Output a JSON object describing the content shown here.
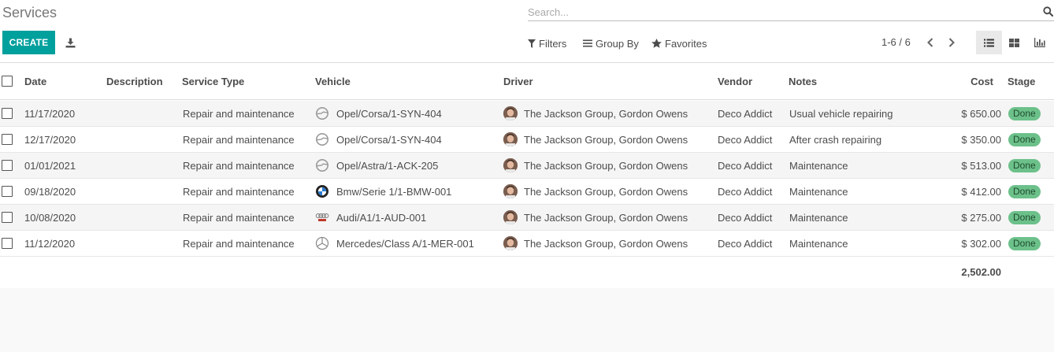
{
  "page": {
    "title": "Services"
  },
  "search": {
    "placeholder": "Search..."
  },
  "buttons": {
    "create": "CREATE"
  },
  "toolbar": {
    "filters": "Filters",
    "group_by": "Group By",
    "favorites": "Favorites"
  },
  "pager": {
    "value": "1-6 / 6"
  },
  "views": [
    "list",
    "kanban",
    "graph"
  ],
  "active_view": "list",
  "table": {
    "columns": {
      "date": "Date",
      "description": "Description",
      "service_type": "Service Type",
      "vehicle": "Vehicle",
      "driver": "Driver",
      "vendor": "Vendor",
      "notes": "Notes",
      "cost": "Cost",
      "stage": "Stage"
    },
    "rows": [
      {
        "date": "11/17/2020",
        "description": "",
        "service_type": "Repair and maintenance",
        "vehicle": "Opel/Corsa/1-SYN-404",
        "vehicle_icon": "opel-logo-icon",
        "driver": "The Jackson Group, Gordon Owens",
        "vendor": "Deco Addict",
        "notes": "Usual vehicle repairing",
        "cost": "$ 650.00",
        "stage": "Done"
      },
      {
        "date": "12/17/2020",
        "description": "",
        "service_type": "Repair and maintenance",
        "vehicle": "Opel/Corsa/1-SYN-404",
        "vehicle_icon": "opel-logo-icon",
        "driver": "The Jackson Group, Gordon Owens",
        "vendor": "Deco Addict",
        "notes": "After crash repairing",
        "cost": "$ 350.00",
        "stage": "Done"
      },
      {
        "date": "01/01/2021",
        "description": "",
        "service_type": "Repair and maintenance",
        "vehicle": "Opel/Astra/1-ACK-205",
        "vehicle_icon": "opel-logo-icon",
        "driver": "The Jackson Group, Gordon Owens",
        "vendor": "Deco Addict",
        "notes": "Maintenance",
        "cost": "$ 513.00",
        "stage": "Done"
      },
      {
        "date": "09/18/2020",
        "description": "",
        "service_type": "Repair and maintenance",
        "vehicle": "Bmw/Serie 1/1-BMW-001",
        "vehicle_icon": "bmw-logo-icon",
        "driver": "The Jackson Group, Gordon Owens",
        "vendor": "Deco Addict",
        "notes": "Maintenance",
        "cost": "$ 412.00",
        "stage": "Done"
      },
      {
        "date": "10/08/2020",
        "description": "",
        "service_type": "Repair and maintenance",
        "vehicle": "Audi/A1/1-AUD-001",
        "vehicle_icon": "audi-logo-icon",
        "driver": "The Jackson Group, Gordon Owens",
        "vendor": "Deco Addict",
        "notes": "Maintenance",
        "cost": "$ 275.00",
        "stage": "Done"
      },
      {
        "date": "11/12/2020",
        "description": "",
        "service_type": "Repair and maintenance",
        "vehicle": "Mercedes/Class A/1-MER-001",
        "vehicle_icon": "mercedes-logo-icon",
        "driver": "The Jackson Group, Gordon Owens",
        "vendor": "Deco Addict",
        "notes": "Maintenance",
        "cost": "$ 302.00",
        "stage": "Done"
      }
    ],
    "total_cost": "2,502.00"
  },
  "colors": {
    "primary": "#00a09d",
    "done_badge": "#6cc18a"
  }
}
